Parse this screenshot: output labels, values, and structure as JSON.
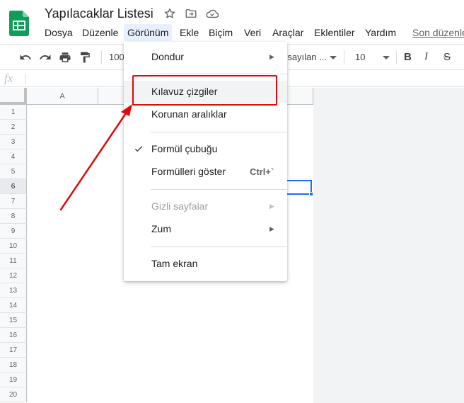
{
  "app": {
    "title": "Yapılacaklar Listesi",
    "last_edit": "Son düzenle"
  },
  "menubar": {
    "items": [
      {
        "label": "Dosya"
      },
      {
        "label": "Düzenle"
      },
      {
        "label": "Görünüm",
        "active": true
      },
      {
        "label": "Ekle"
      },
      {
        "label": "Biçim"
      },
      {
        "label": "Veri"
      },
      {
        "label": "Araçlar"
      },
      {
        "label": "Eklentiler"
      },
      {
        "label": "Yardım"
      }
    ]
  },
  "toolbar": {
    "zoom": "100",
    "font": "rsayılan ...",
    "font_size": "10",
    "bold": "B",
    "italic": "I",
    "strike": "S"
  },
  "formula_bar": {
    "fx": "fx"
  },
  "grid": {
    "columns": [
      "A"
    ],
    "rows": [
      "1",
      "2",
      "3",
      "4",
      "5",
      "6",
      "7",
      "8",
      "9",
      "10",
      "11",
      "12",
      "13",
      "14",
      "15",
      "16",
      "17",
      "18",
      "19",
      "20"
    ],
    "selected_row": "6"
  },
  "dropdown": {
    "freeze": "Dondur",
    "gridlines": "Kılavuz çizgiler",
    "protected_ranges": "Korunan aralıklar",
    "formula_bar": "Formül çubuğu",
    "show_formulas": "Formülleri göster",
    "show_formulas_shortcut": "Ctrl+`",
    "hidden_sheets": "Gizli sayfalar",
    "zoom": "Zum",
    "full_screen": "Tam ekran",
    "submenu_arrow": "▶"
  },
  "colors": {
    "annotation": "#e10909",
    "accent": "#1a73e8",
    "sheets_green": "#0f9d58"
  }
}
